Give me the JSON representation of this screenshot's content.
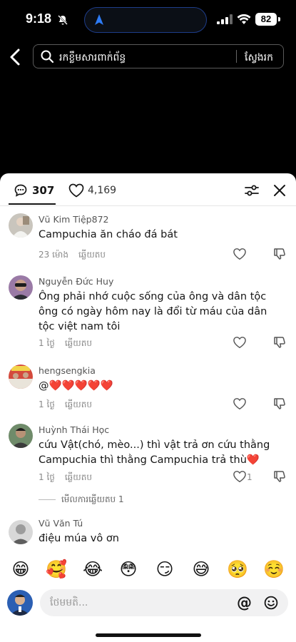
{
  "status_bar": {
    "time": "9:18",
    "battery": "82",
    "icons": [
      "silent-bell-icon",
      "navigation-arrow-icon",
      "signal-icon",
      "wifi-icon",
      "battery-icon"
    ]
  },
  "top_bar": {
    "search_placeholder": "រកខ្លឹមសារពាក់ព័ន្ធ",
    "search_button": "ស្វែងរក"
  },
  "sheet": {
    "comment_count": "307",
    "like_count": "4,169"
  },
  "comments": [
    {
      "user": "Vũ Kim Tiệp872",
      "text": "Campuchia ăn cháo đá bát",
      "time": "23 ម៉ោង",
      "reply": "ឆ្លើយតប",
      "likes": ""
    },
    {
      "user": "Nguyễn Đức Huy",
      "text": "Ông phải nhớ cuộc sống của ông và dân tộc ông có ngày hôm nay là đổi từ máu của dân tộc việt nam tôi",
      "time": "1 ថ្ងៃ",
      "reply": "ឆ្លើយតប",
      "likes": ""
    },
    {
      "user": "hengsengkia",
      "text": "@❤️❤️❤️❤️❤️",
      "time": "1 ថ្ងៃ",
      "reply": "ឆ្លើយតប",
      "likes": ""
    },
    {
      "user": "Huỳnh Thái Học",
      "text": "cứu Vật(chó, mèo...) thì vật trả ơn cứu thằng Campuchia thì thằng Campuchia trả thù❤️",
      "time": "1 ថ្ងៃ",
      "reply": "ឆ្លើយតប",
      "likes": "1",
      "view_replies": "មើលការឆ្លើយតប 1"
    },
    {
      "user": "Vũ Văn Tú",
      "text": "điệu múa vô ơn",
      "time": "",
      "reply": "",
      "likes": ""
    }
  ],
  "emoji_bar": [
    "😁",
    "🥰",
    "😂",
    "😳",
    "😏",
    "😅",
    "🥺",
    "☺️"
  ],
  "composer": {
    "placeholder": "ថែមមតិ...",
    "at_symbol": "@"
  },
  "colors": {
    "heart_red": "#e3173e",
    "text_primary": "#161616",
    "text_muted": "#8a8a8a"
  }
}
